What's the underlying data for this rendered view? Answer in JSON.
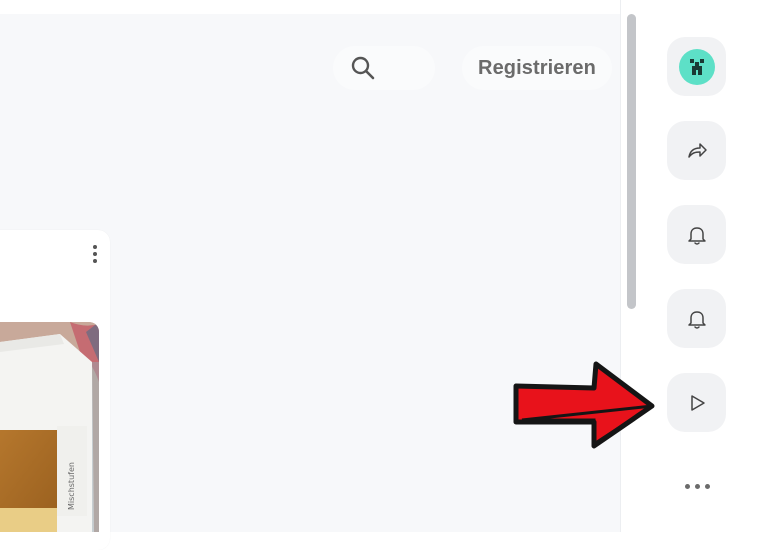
{
  "header": {
    "search_icon": "search-icon",
    "register_label": "Registrieren"
  },
  "card": {
    "menu_icon": "more-vertical-icon",
    "image_handwriting": "Mischstufen"
  },
  "sidebar": {
    "buttons": [
      {
        "icon": "avatar-icon"
      },
      {
        "icon": "share-icon"
      },
      {
        "icon": "bell-icon"
      },
      {
        "icon": "bell-icon"
      },
      {
        "icon": "play-icon"
      },
      {
        "icon": "more-horizontal-icon"
      }
    ]
  },
  "annotation": {
    "icon": "red-arrow-icon",
    "color": "#e8121b"
  },
  "colors": {
    "avatar_bg": "#5de0c7",
    "accent_red": "#e8121b",
    "icon_gray": "#555555"
  }
}
